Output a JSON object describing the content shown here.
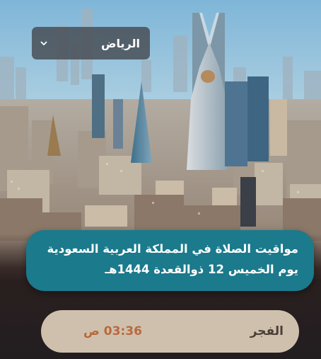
{
  "city_selector": {
    "selected": "الرياض",
    "chevron_icon": "chevron-down-icon"
  },
  "banner": {
    "line1": "مواقيت الصلاة في المملكة العربية السعودية",
    "line2": "يوم الخميس 12 ذوالقعدة 1444هـ"
  },
  "prayers": [
    {
      "name": "الفجر",
      "time": "03:36 ص"
    }
  ],
  "colors": {
    "banner": "#1b7a8c",
    "prayer_row": "#cfc0ad",
    "prayer_time": "#b8693d",
    "prayer_name": "#4a3f36",
    "dropdown": "#464a50"
  }
}
